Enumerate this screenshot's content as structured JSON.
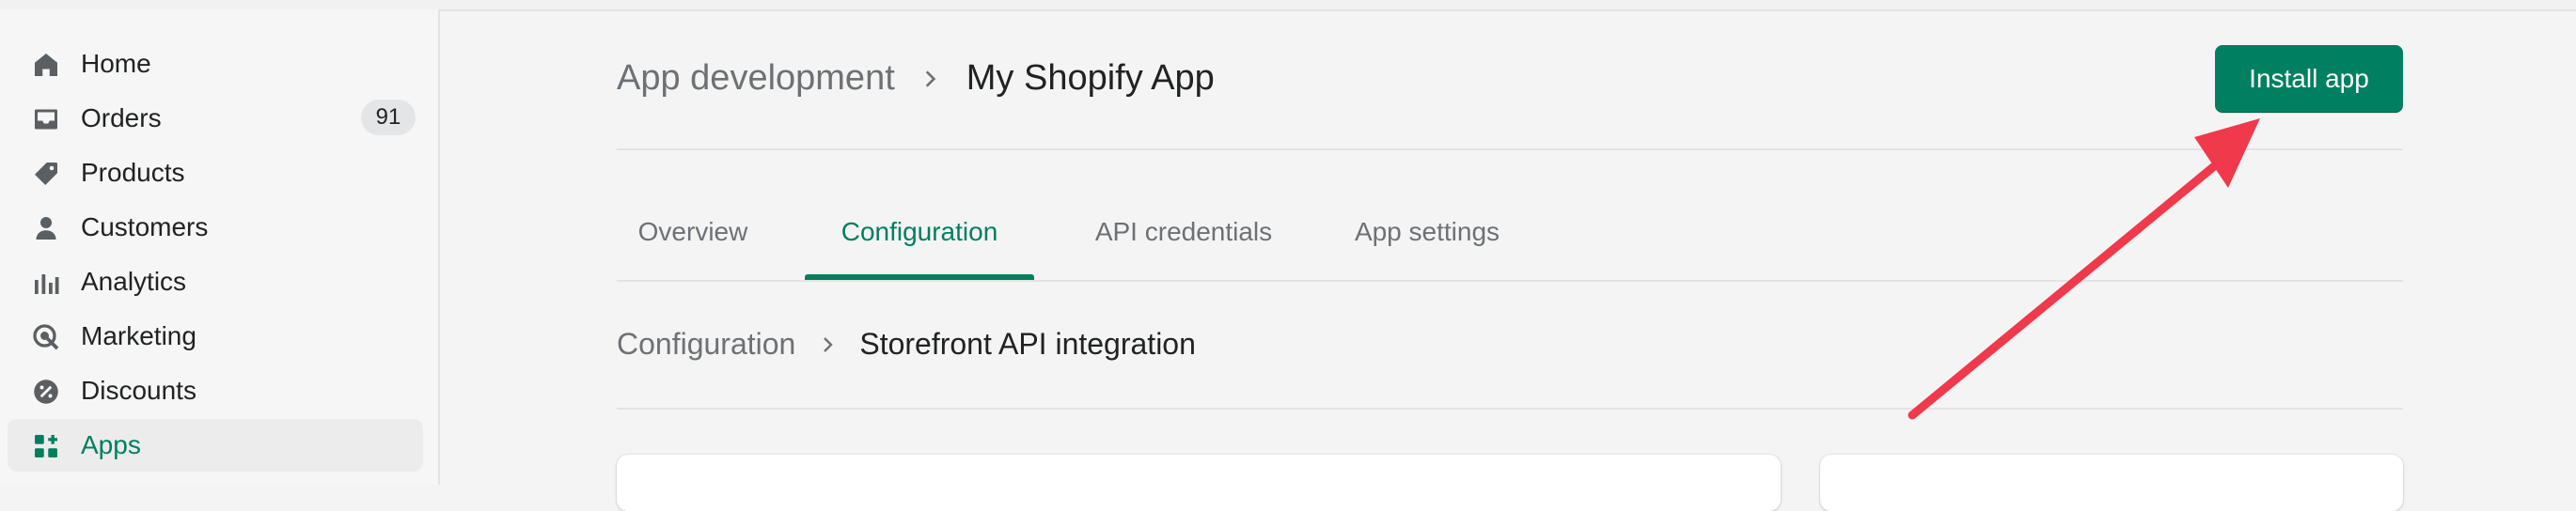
{
  "sidebar": {
    "items": [
      {
        "label": "Home",
        "icon": "home-icon"
      },
      {
        "label": "Orders",
        "icon": "inbox-icon",
        "badge": "91"
      },
      {
        "label": "Products",
        "icon": "tag-icon"
      },
      {
        "label": "Customers",
        "icon": "person-icon"
      },
      {
        "label": "Analytics",
        "icon": "bar-chart-icon"
      },
      {
        "label": "Marketing",
        "icon": "target-icon"
      },
      {
        "label": "Discounts",
        "icon": "discount-icon"
      },
      {
        "label": "Apps",
        "icon": "apps-icon",
        "active": true
      }
    ]
  },
  "header": {
    "breadcrumb_parent": "App development",
    "title": "My Shopify App",
    "install_label": "Install app"
  },
  "tabs": [
    {
      "label": "Overview"
    },
    {
      "label": "Configuration",
      "active": true
    },
    {
      "label": "API credentials"
    },
    {
      "label": "App settings"
    }
  ],
  "subheader": {
    "breadcrumb_parent": "Configuration",
    "title": "Storefront API integration"
  },
  "colors": {
    "accent": "#008060",
    "accent_text": "#007f5f",
    "annotation_arrow": "#f0394b",
    "background": "#f4f4f4"
  }
}
